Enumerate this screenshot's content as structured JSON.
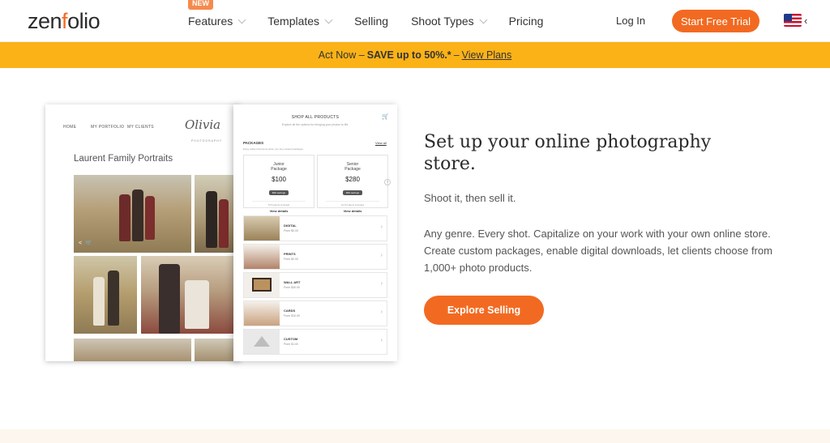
{
  "header": {
    "logo_pre": "zen",
    "logo_accent": "f",
    "logo_post": "olio",
    "nav": [
      {
        "label": "Features",
        "badge": "NEW",
        "has_dropdown": true
      },
      {
        "label": "Templates",
        "has_dropdown": true
      },
      {
        "label": "Selling",
        "has_dropdown": false
      },
      {
        "label": "Shoot Types",
        "has_dropdown": true
      },
      {
        "label": "Pricing",
        "has_dropdown": false
      }
    ],
    "login": "Log In",
    "trial_button": "Start Free Trial",
    "language_icon": "us-flag-icon",
    "language_chevron": "‹"
  },
  "promo": {
    "prefix": "Act Now –",
    "highlight": "SAVE up to 50%.*",
    "separator": "–",
    "link": "View Plans"
  },
  "hero": {
    "title": "Set up your online photography store.",
    "subtitle": "Shoot it, then sell it.",
    "body": "Any genre. Every shot. Capitalize on your work with your own online store. Create custom packages, enable digital downloads, let clients choose from 1,000+ photo products.",
    "cta": "Explore Selling"
  },
  "mockup": {
    "site_nav": [
      "HOME",
      "MY PORTFOLIO",
      "MY CLIENTS"
    ],
    "signature": "Olivia",
    "signature_sub": "PHOTOGRAPHY",
    "gallery_title": "Laurent Family Portraits",
    "shop": {
      "title": "SHOP ALL PRODUCTS",
      "subtitle": "Explore all the options for bringing your photos to life.",
      "packages_label": "PACKAGES",
      "view_all": "View all",
      "packages_desc": "Enjoy added discounts when you buy curated packages",
      "packages": [
        {
          "name1": "Junior",
          "name2": "Package",
          "price": "$100",
          "pill": "$20 savings",
          "count": "8 Products included",
          "link": "View details"
        },
        {
          "name1": "Senior",
          "name2": "Package",
          "price": "$280",
          "pill": "$30 savings",
          "count": "10 Products included",
          "link": "View details"
        }
      ],
      "categories": [
        {
          "name": "DIGITAL",
          "price": "From $0.00"
        },
        {
          "name": "PRINTS",
          "price": "From $2.00"
        },
        {
          "name": "WALL ART",
          "price": "From $30.00"
        },
        {
          "name": "CARDS",
          "price": "From $10.00"
        },
        {
          "name": "CUSTOM",
          "price": "From $1.00"
        }
      ]
    }
  },
  "colors": {
    "accent": "#f26a21",
    "promo_bg": "#fbb217",
    "badge": "#f58a4e"
  }
}
